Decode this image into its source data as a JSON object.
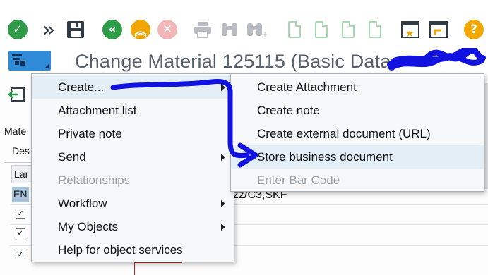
{
  "toolbar": {
    "icons": [
      {
        "name": "check-icon",
        "glyph": "✓"
      },
      {
        "name": "double-chevron-right-icon",
        "glyph": "»"
      },
      {
        "name": "save-icon",
        "glyph": "▣"
      },
      {
        "name": "back-icon",
        "glyph": "«"
      },
      {
        "name": "exit-icon",
        "glyph": "⌃"
      },
      {
        "name": "cancel-icon",
        "glyph": "✕"
      },
      {
        "name": "print-icon",
        "glyph": "▤"
      },
      {
        "name": "find-icon",
        "glyph": "∞"
      },
      {
        "name": "find-next-icon",
        "glyph": "∞"
      },
      {
        "name": "help-icon",
        "glyph": "?"
      }
    ]
  },
  "title": {
    "text": "Change Material 125115 (Basic Data,"
  },
  "background": {
    "label_mate": "Mate",
    "tab_des": "Des",
    "col_lang": "Lar",
    "lang_value": "EN",
    "visible_value": "zz/C3,SKF"
  },
  "menu_main": {
    "items": [
      {
        "label": "Create...",
        "enabled": true,
        "submenu": true
      },
      {
        "label": "Attachment list",
        "enabled": true,
        "submenu": false
      },
      {
        "label": "Private note",
        "enabled": true,
        "submenu": false
      },
      {
        "label": "Send",
        "enabled": true,
        "submenu": true
      },
      {
        "label": "Relationships",
        "enabled": false,
        "submenu": false
      },
      {
        "label": "Workflow",
        "enabled": true,
        "submenu": true
      },
      {
        "label": "My Objects",
        "enabled": true,
        "submenu": true
      },
      {
        "label": "Help for object services",
        "enabled": true,
        "submenu": false
      }
    ]
  },
  "menu_sub": {
    "items": [
      {
        "label": "Create Attachment",
        "enabled": true
      },
      {
        "label": "Create note",
        "enabled": true
      },
      {
        "label": "Create external document (URL)",
        "enabled": true
      },
      {
        "label": "Store business document",
        "enabled": true
      },
      {
        "label": "Enter Bar Code",
        "enabled": false
      }
    ]
  },
  "colors": {
    "accent_blue": "#2f8ad8",
    "annotation_blue": "#1212e0",
    "ok_green": "#2e9b46",
    "warn_orange": "#f0a500"
  }
}
